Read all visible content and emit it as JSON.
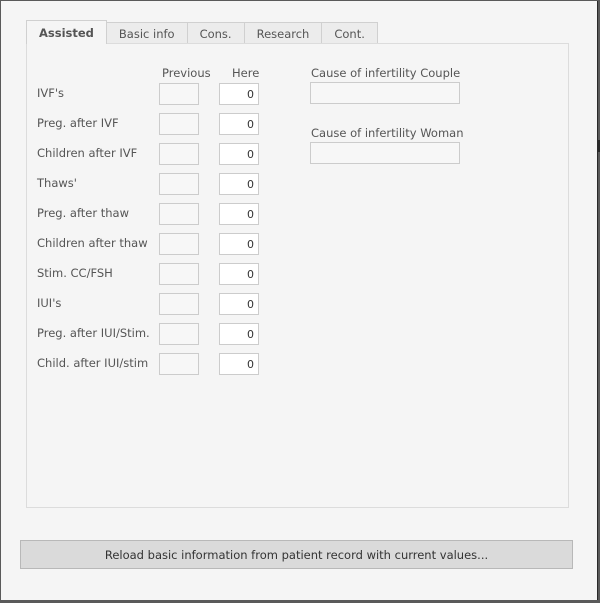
{
  "tabs": [
    {
      "label": "Assisted",
      "active": true
    },
    {
      "label": "Basic info",
      "active": false
    },
    {
      "label": "Cons.",
      "active": false
    },
    {
      "label": "Research",
      "active": false
    },
    {
      "label": "Cont.",
      "active": false
    }
  ],
  "columns": {
    "previous": "Previous",
    "here": "Here"
  },
  "rows": [
    {
      "label": "IVF's",
      "previous": "",
      "here": "0"
    },
    {
      "label": "Preg. after IVF",
      "previous": "",
      "here": "0"
    },
    {
      "label": "Children after IVF",
      "previous": "",
      "here": "0"
    },
    {
      "label": "Thaws'",
      "previous": "",
      "here": "0"
    },
    {
      "label": "Preg. after thaw",
      "previous": "",
      "here": "0"
    },
    {
      "label": "Children after thaw",
      "previous": "",
      "here": "0"
    },
    {
      "label": "Stim. CC/FSH",
      "previous": "",
      "here": "0"
    },
    {
      "label": "IUI's",
      "previous": "",
      "here": "0"
    },
    {
      "label": "Preg. after IUI/Stim.",
      "previous": "",
      "here": "0"
    },
    {
      "label": "Child. after IUI/stim",
      "previous": "",
      "here": "0"
    }
  ],
  "causes": {
    "couple_label": "Cause of infertility Couple",
    "couple_value": "",
    "woman_label": "Cause of infertility Woman",
    "woman_value": ""
  },
  "reload_button": "Reload basic information from patient record with current values..."
}
